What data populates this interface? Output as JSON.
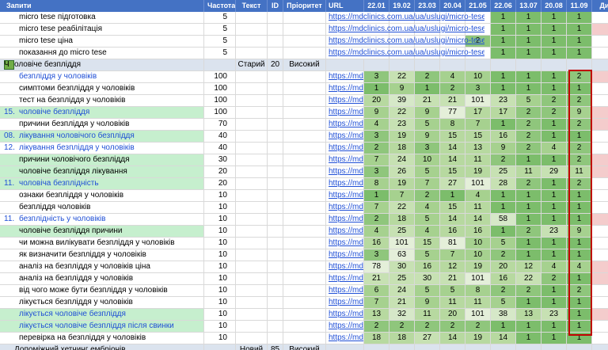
{
  "header": {
    "query": "Запити",
    "freq": "Частота",
    "text": "Текст",
    "id": "ID",
    "priority": "Пріоритет",
    "url": "URL",
    "dates": [
      "22.01",
      "19.02",
      "23.03",
      "20.04",
      "21.05",
      "22.06",
      "13.07",
      "20.08",
      "11.09",
      "Ди"
    ]
  },
  "colors": {
    "header_bg": "#4472c4",
    "group_bg": "#dbe3ee",
    "highlight_bg": "#c6efce",
    "box": "#c00000"
  },
  "rows": [
    {
      "type": "data",
      "pre": "",
      "q": "micro tese підготовка",
      "f": "5",
      "url": "https://mdclinics.com.ua/ua/uslugi/micro-tese/",
      "urlwide": true,
      "d": [
        "",
        "",
        "",
        "",
        "",
        "1",
        "1",
        "1",
        "1",
        ""
      ]
    },
    {
      "type": "data",
      "pre": "",
      "q": "micro tese реабілітація",
      "f": "5",
      "url": "https://mdclinics.com.ua/ua/uslugi/micro-tese/",
      "urlwide": true,
      "d": [
        "",
        "",
        "",
        "",
        "",
        "1",
        "1",
        "1",
        "1",
        ""
      ]
    },
    {
      "type": "data",
      "pre": "",
      "q": "micro tese ціна",
      "f": "5",
      "url": "https://mdclinics.com.ua/ua/uslugi/micro-tese/",
      "urlwide": true,
      "d": [
        "",
        "",
        "",
        "",
        "2",
        "1",
        "1",
        "1",
        "1",
        ""
      ]
    },
    {
      "type": "data",
      "pre": "",
      "q": "показання до micro tese",
      "f": "5",
      "url": "https://mdclinics.com.ua/ua/uslugi/micro-tese/",
      "urlwide": true,
      "d": [
        "",
        "",
        "",
        "",
        "",
        "1",
        "1",
        "1",
        "1",
        ""
      ]
    },
    {
      "type": "group",
      "pre": "Ч",
      "q": "оловіче безпліддя",
      "f": "",
      "t": "Старий",
      "id": "20",
      "p": "Високий",
      "url": "",
      "d": [
        "",
        "",
        "",
        "",
        "",
        "",
        "",
        "",
        "",
        ""
      ]
    },
    {
      "type": "data",
      "pre": "",
      "q": "безпліддя у чоловіків",
      "blue": true,
      "f": "100",
      "url": "https://mdc",
      "d": [
        "3",
        "22",
        "2",
        "4",
        "10",
        "1",
        "1",
        "1",
        "2",
        ""
      ]
    },
    {
      "type": "data",
      "pre": "",
      "q": "симптоми безпліддя у чоловіків",
      "f": "100",
      "url": "https://mdc",
      "d": [
        "1",
        "9",
        "1",
        "2",
        "3",
        "1",
        "1",
        "1",
        "1",
        ""
      ]
    },
    {
      "type": "data",
      "pre": "",
      "q": "тест на безпліддя у чоловіків",
      "f": "100",
      "url": "https://mdc",
      "d": [
        "20",
        "39",
        "21",
        "21",
        "101",
        "23",
        "5",
        "2",
        "2",
        ""
      ]
    },
    {
      "type": "data",
      "pre": "15.",
      "q": "чоловіче безпліддя",
      "blue": true,
      "hl": true,
      "f": "100",
      "url": "https://mdc",
      "d": [
        "9",
        "22",
        "9",
        "77",
        "17",
        "17",
        "2",
        "2",
        "9",
        ""
      ]
    },
    {
      "type": "data",
      "pre": "",
      "q": "причини безпліддя у чоловіків",
      "f": "70",
      "url": "https://mdc",
      "d": [
        "4",
        "23",
        "5",
        "8",
        "7",
        "1",
        "2",
        "1",
        "2",
        ""
      ]
    },
    {
      "type": "data",
      "pre": "08.",
      "q": "лікування чоловічого безпліддя",
      "blue": true,
      "hl": true,
      "f": "40",
      "url": "https://mdc",
      "d": [
        "3",
        "19",
        "9",
        "15",
        "15",
        "16",
        "2",
        "1",
        "1",
        ""
      ]
    },
    {
      "type": "data",
      "pre": "12.",
      "q": "лікування безпліддя у чоловіків",
      "blue": true,
      "f": "40",
      "url": "https://mdc",
      "d": [
        "2",
        "18",
        "3",
        "14",
        "13",
        "9",
        "2",
        "4",
        "2",
        ""
      ]
    },
    {
      "type": "data",
      "pre": "",
      "q": "причини чоловічого безпліддя",
      "hl": true,
      "f": "30",
      "url": "https://mdc",
      "d": [
        "7",
        "24",
        "10",
        "14",
        "11",
        "2",
        "1",
        "1",
        "2",
        ""
      ]
    },
    {
      "type": "data",
      "pre": "",
      "q": "чоловіче безпліддя лікування",
      "hl": true,
      "f": "20",
      "url": "https://mdc",
      "d": [
        "3",
        "26",
        "5",
        "15",
        "19",
        "25",
        "11",
        "29",
        "11",
        ""
      ]
    },
    {
      "type": "data",
      "pre": "11.",
      "q": "чоловіча безплідність",
      "blue": true,
      "hl": true,
      "f": "20",
      "url": "https://mdc",
      "d": [
        "8",
        "19",
        "7",
        "27",
        "101",
        "28",
        "2",
        "1",
        "2",
        ""
      ]
    },
    {
      "type": "data",
      "pre": "",
      "q": "ознаки безпліддя у чоловіків",
      "f": "10",
      "url": "https://mdc",
      "d": [
        "1",
        "7",
        "2",
        "1",
        "4",
        "1",
        "1",
        "1",
        "1",
        ""
      ]
    },
    {
      "type": "data",
      "pre": "",
      "q": "безпліддя чоловіків",
      "f": "10",
      "url": "https://mdc",
      "d": [
        "7",
        "22",
        "4",
        "15",
        "11",
        "1",
        "1",
        "1",
        "1",
        ""
      ]
    },
    {
      "type": "data",
      "pre": "11.",
      "q": "безплідність у чоловіків",
      "blue": true,
      "f": "10",
      "url": "https://mdc",
      "d": [
        "2",
        "18",
        "5",
        "14",
        "14",
        "58",
        "1",
        "1",
        "1",
        ""
      ]
    },
    {
      "type": "data",
      "pre": "",
      "q": "чоловіче безпліддя причини",
      "hl": true,
      "f": "10",
      "url": "https://mdc",
      "d": [
        "4",
        "25",
        "4",
        "16",
        "16",
        "1",
        "2",
        "23",
        "9",
        ""
      ]
    },
    {
      "type": "data",
      "pre": "",
      "q": "чи можна вилікувати безпліддя у чоловіків",
      "f": "10",
      "url": "https://mdc",
      "d": [
        "16",
        "101",
        "15",
        "81",
        "10",
        "5",
        "1",
        "1",
        "1",
        ""
      ]
    },
    {
      "type": "data",
      "pre": "",
      "q": "як визначити безпліддя у чоловіків",
      "f": "10",
      "url": "https://mdc",
      "d": [
        "3",
        "63",
        "5",
        "7",
        "10",
        "2",
        "1",
        "1",
        "1",
        ""
      ]
    },
    {
      "type": "data",
      "pre": "",
      "q": "аналіз на безпліддя у чоловіків ціна",
      "f": "10",
      "url": "https://mdc",
      "d": [
        "78",
        "30",
        "16",
        "12",
        "19",
        "20",
        "12",
        "4",
        "4",
        ""
      ]
    },
    {
      "type": "data",
      "pre": "",
      "q": "аналіз на безпліддя у чоловіків",
      "f": "10",
      "url": "https://mdc",
      "d": [
        "21",
        "25",
        "30",
        "21",
        "101",
        "16",
        "22",
        "2",
        "1",
        ""
      ]
    },
    {
      "type": "data",
      "pre": "",
      "q": "від чого може бути безпліддя у чоловіків",
      "f": "10",
      "url": "https://mdc",
      "d": [
        "6",
        "24",
        "5",
        "5",
        "8",
        "2",
        "2",
        "1",
        "2",
        ""
      ]
    },
    {
      "type": "data",
      "pre": "",
      "q": "лікується безпліддя у чоловіків",
      "f": "10",
      "url": "https://mdc",
      "d": [
        "7",
        "21",
        "9",
        "11",
        "11",
        "5",
        "1",
        "1",
        "1",
        ""
      ]
    },
    {
      "type": "data",
      "pre": "",
      "q": "лікується чоловіче безпліддя",
      "blue": true,
      "hl": true,
      "f": "10",
      "url": "https://mdc",
      "d": [
        "13",
        "32",
        "11",
        "20",
        "101",
        "38",
        "13",
        "23",
        "1",
        ""
      ]
    },
    {
      "type": "data",
      "pre": "",
      "q": "лікується чоловіче безпліддя після свинки",
      "blue": true,
      "hl": true,
      "f": "10",
      "url": "https://mdc",
      "d": [
        "2",
        "2",
        "2",
        "2",
        "2",
        "1",
        "1",
        "1",
        "1",
        ""
      ]
    },
    {
      "type": "data",
      "pre": "",
      "q": "перевірка на безпліддя у чоловіків",
      "f": "10",
      "url": "https://mdc",
      "d": [
        "18",
        "18",
        "27",
        "14",
        "19",
        "14",
        "1",
        "1",
        "1",
        ""
      ]
    },
    {
      "type": "group",
      "pre": "",
      "q": "Допоміжний хетчинг ембріонів",
      "f": "",
      "t": "Новий",
      "id": "85",
      "p": "Високий",
      "url": "",
      "d": [
        "",
        "",
        "",
        "",
        "",
        "",
        "",
        "",
        "",
        ""
      ]
    }
  ]
}
